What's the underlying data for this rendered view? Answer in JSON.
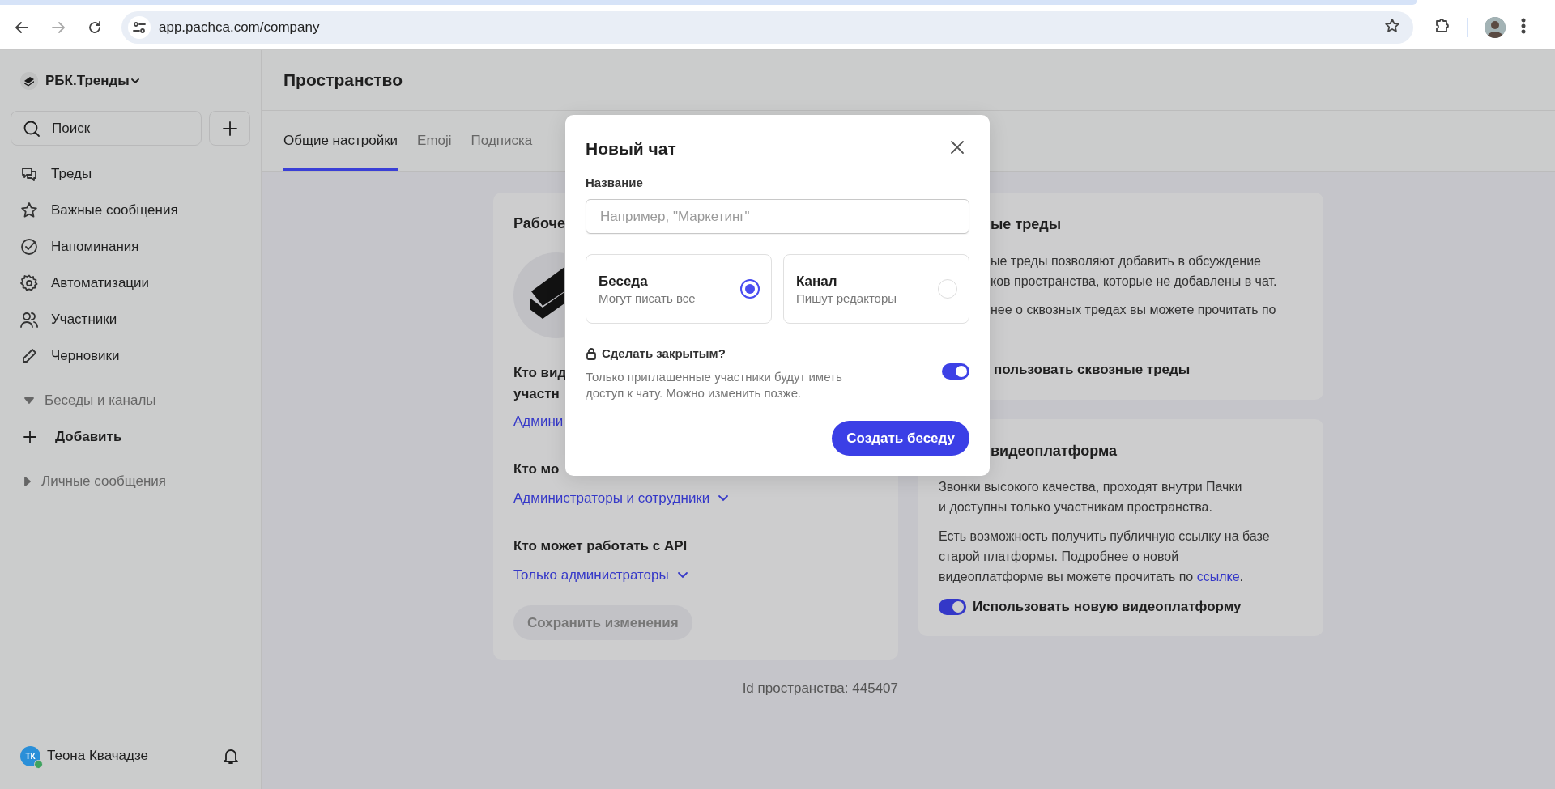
{
  "browser": {
    "url": "app.pachca.com/company"
  },
  "sidebar": {
    "workspace": "РБК.Тренды",
    "search": {
      "placeholder": "Поиск"
    },
    "nav": [
      {
        "label": "Треды"
      },
      {
        "label": "Важные сообщения"
      },
      {
        "label": "Напоминания"
      },
      {
        "label": "Автоматизации"
      },
      {
        "label": "Участники"
      },
      {
        "label": "Черновики"
      }
    ],
    "groups": [
      {
        "label": "Беседы и каналы",
        "expanded": true,
        "children": [
          {
            "label": "Добавить"
          }
        ]
      },
      {
        "label": "Личные сообщения",
        "expanded": false
      }
    ],
    "user": {
      "name": "Теона Квачадзе",
      "initials": "ТК",
      "online": true
    }
  },
  "main": {
    "title": "Пространство",
    "tabs": [
      {
        "label": "Общие настройки",
        "selected": true
      },
      {
        "label": "Emoji",
        "selected": false
      },
      {
        "label": "Подписка",
        "selected": false
      }
    ],
    "workspace_card": {
      "title": "Рабоче",
      "settings": [
        {
          "question": "Кто вид\nучастн",
          "value": "Админи"
        },
        {
          "question": "Кто мо",
          "value": "Администраторы и сотрудники",
          "dropdown": true
        },
        {
          "question": "Кто может работать с API",
          "value": "Только администраторы",
          "dropdown": true
        }
      ],
      "save_button": {
        "label": "Сохранить изменения",
        "disabled": true
      }
    },
    "space_id": "Id пространства: 445407",
    "threads_card": {
      "title": "ые треды",
      "paragraphs": [
        [
          "ые треды позволяют добавить в обсуждение",
          "ков пространства, которые не добавлены в чат."
        ],
        [
          "нее о сквозных тредах вы можете прочитать по"
        ]
      ],
      "toggle_label": "пользовать сквозные треды"
    },
    "video_card": {
      "title": "видеоплатформа",
      "paragraph": "Звонки высокого качества, проходят внутри Пачки\nи доступны только участникам пространства.",
      "paragraph_2": {
        "text": "Есть возможность получить публичную ссылку на базе\nстарой платформы. Подробнее о новой\nвидеоплатформе вы можете прочитать по ",
        "link": "ссылке",
        "after": "."
      },
      "toggle": {
        "label": "Использовать новую видеоплатформу",
        "on": true
      }
    }
  },
  "modal": {
    "title": "Новый чат",
    "name_field": {
      "label": "Название",
      "placeholder": "Например, \"Маркетинг\""
    },
    "types": [
      {
        "title": "Беседа",
        "subtitle": "Могут писать все",
        "selected": true
      },
      {
        "title": "Канал",
        "subtitle": "Пишут редакторы",
        "selected": false
      }
    ],
    "private": {
      "label": "Сделать закрытым?",
      "hint": "Только приглашенные участники будут иметь\nдоступ к чату. Можно изменить позже.",
      "on": true
    },
    "submit": "Создать беседу"
  }
}
